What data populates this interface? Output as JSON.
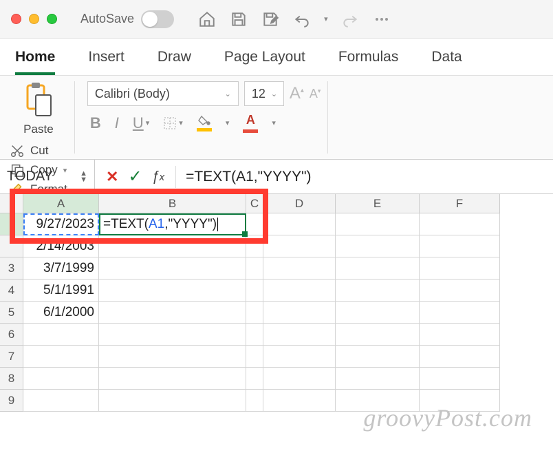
{
  "titlebar": {
    "autosave_label": "AutoSave"
  },
  "tabs": [
    "Home",
    "Insert",
    "Draw",
    "Page Layout",
    "Formulas",
    "Data"
  ],
  "active_tab": "Home",
  "ribbon": {
    "paste_label": "Paste",
    "cut_label": "Cut",
    "copy_label": "Copy",
    "format_label": "Format",
    "font_name": "Calibri (Body)",
    "font_size": "12",
    "bold": "B",
    "italic": "I",
    "underline": "U",
    "font_a": "A",
    "font_a2": "A"
  },
  "namebox": "TODAY",
  "formula_fx": "fx",
  "formula_value": "=TEXT(A1,\"YYYY\")",
  "columns": [
    "A",
    "B",
    "C",
    "D",
    "E",
    "F"
  ],
  "rows": {
    "r1": {
      "num": "",
      "A": "9/27/2023",
      "B_pre": "=TEXT(",
      "B_ref": "A1",
      "B_post": ",\"YYYY\")"
    },
    "r2": {
      "num": "",
      "A": "2/14/2003"
    },
    "r3": {
      "num": "3",
      "A": "3/7/1999"
    },
    "r4": {
      "num": "4",
      "A": "5/1/1991"
    },
    "r5": {
      "num": "5",
      "A": "6/1/2000"
    },
    "r6": {
      "num": "6"
    },
    "r7": {
      "num": "7"
    },
    "r8": {
      "num": "8"
    },
    "r9": {
      "num": "9"
    }
  },
  "watermark": "groovyPost.com"
}
